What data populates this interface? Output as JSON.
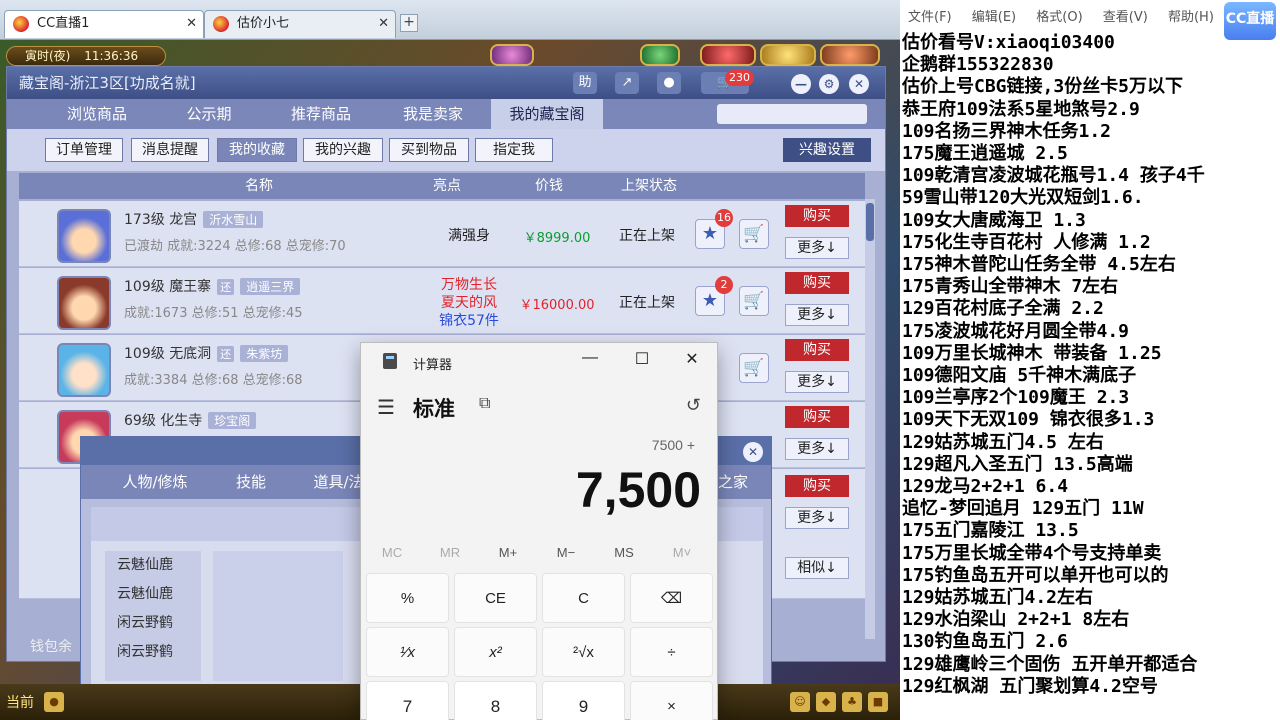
{
  "browser": {
    "tabs": [
      {
        "label": "CC直播1",
        "close": "✕",
        "active": true
      },
      {
        "label": "估价小七",
        "close": "✕",
        "active": false
      }
    ],
    "new_tab": "+"
  },
  "game": {
    "time_label": "寅时(夜)",
    "clock": "11:36:36",
    "window_title": "藏宝阁-浙江3区[功成名就]",
    "title_buttons": {
      "help": "助",
      "share": "↗",
      "record": "●",
      "chat_count": "230",
      "cart": "🛒"
    },
    "nav_tabs": [
      "浏览商品",
      "公示期",
      "推荐商品",
      "我是卖家",
      "我的藏宝阁"
    ],
    "active_nav": "我的藏宝阁",
    "search_placeholder": "",
    "sub_tabs": [
      "订单管理",
      "消息提醒",
      "我的收藏",
      "我的兴趣",
      "买到物品",
      "指定我"
    ],
    "active_sub": "我的收藏",
    "interest_button": "兴趣设置",
    "table_headers": [
      "名称",
      "亮点",
      "价钱",
      "上架状态"
    ],
    "rows": [
      {
        "level": "173级",
        "school": "龙宫",
        "server": "沂水雪山",
        "line2": "已渡劫 成就:3224 总修:68 总宠修:70",
        "highlight": [
          "满强身"
        ],
        "price": "￥8999.00",
        "price_color": "#0a9e2e",
        "status": "正在上架",
        "fav": "16",
        "buy": "购买",
        "more": "更多↓"
      },
      {
        "level": "109级",
        "school": "魔王寨",
        "badge": "还",
        "server": "逍遥三界",
        "line2": "成就:1673 总修:51 总宠修:45",
        "highlight": [
          "万物生长",
          "夏天的风",
          "锦衣57件"
        ],
        "price": "￥16000.00",
        "price_color": "#e0232b",
        "status": "正在上架",
        "fav": "2",
        "buy": "购买",
        "more": "更多↓"
      },
      {
        "level": "109级",
        "school": "无底洞",
        "badge": "还",
        "server": "朱紫坊",
        "line2": "成就:3384 总修:68 总宠修:68",
        "highlight": [],
        "price": "",
        "status": "",
        "fav": "",
        "buy": "购买",
        "more": "更多↓"
      },
      {
        "level": "69级",
        "school": "化生寺",
        "server": "珍宝阁",
        "line2": "",
        "highlight": [],
        "price": "",
        "status": "",
        "fav": "",
        "buy": "购买",
        "more": "更多↓"
      }
    ],
    "extra_buttons": {
      "buy": "购买",
      "more": "更多↓",
      "similar": "相似↓"
    },
    "wallet_label": "钱包余",
    "bottom_label": "当前",
    "dialog": {
      "tabs": [
        "人物/修炼",
        "技能",
        "道具/法宝",
        "之家"
      ],
      "list": [
        "云魅仙鹿",
        "云魅仙鹿",
        "闲云野鹤",
        "闲云野鹤"
      ],
      "close": "✕"
    }
  },
  "calculator": {
    "title": "计算器",
    "mode": "标准",
    "expression": "7500 +",
    "display": "7,500",
    "memory_keys": [
      "MC",
      "MR",
      "M+",
      "M−",
      "MS",
      "M˅"
    ],
    "keys_row1": [
      "%",
      "CE",
      "C",
      "⌫"
    ],
    "keys_row2": [
      "¹⁄x",
      "x²",
      "²√x",
      "÷"
    ],
    "keys_row3": [
      "7",
      "8",
      "9",
      "×"
    ]
  },
  "notepad": {
    "menu": [
      "文件(F)",
      "编辑(E)",
      "格式(O)",
      "查看(V)",
      "帮助(H)"
    ],
    "logo": "CC直播",
    "lines": [
      "估价看号V:xiaoqi03400",
      "企鹅群155322830",
      "估价上号CBG链接,3份丝卡5万以下",
      "恭王府109法系5星地煞号2.9",
      "109名扬三界神木任务1.2",
      "175魔王逍遥城 2.5",
      "109乾清宫凌波城花瓶号1.4 孩子4千",
      "59雪山带120大光双短剑1.6.",
      "109女大唐威海卫  1.3",
      "175化生寺百花村 人修满 1.2",
      "175神木普陀山任务全带 4.5左右",
      "175青秀山全带神木  7左右",
      "129百花村底子全满 2.2",
      "175凌波城花好月圆全带4.9",
      "109万里长城神木 带装备  1.25",
      "109德阳文庙 5千神木满底子",
      "109兰亭序2个109魔王 2.3",
      "109天下无双109  锦衣很多1.3",
      "129姑苏城五门4.5 左右",
      "129超凡入圣五门  13.5高端",
      "129龙马2+2+1  6.4",
      "追忆-梦回追月 129五门 11W",
      "175五门嘉陵江 13.5",
      "175万里长城全带4个号支持单卖",
      "175钓鱼岛五开可以单开也可以的",
      "129姑苏城五门4.2左右",
      "129水泊梁山 2+2+1 8左右",
      "130钓鱼岛五门  2.6",
      "129雄鹰岭三个固伤 五开单开都适合",
      "129红枫湖 五门聚划算4.2空号"
    ]
  }
}
